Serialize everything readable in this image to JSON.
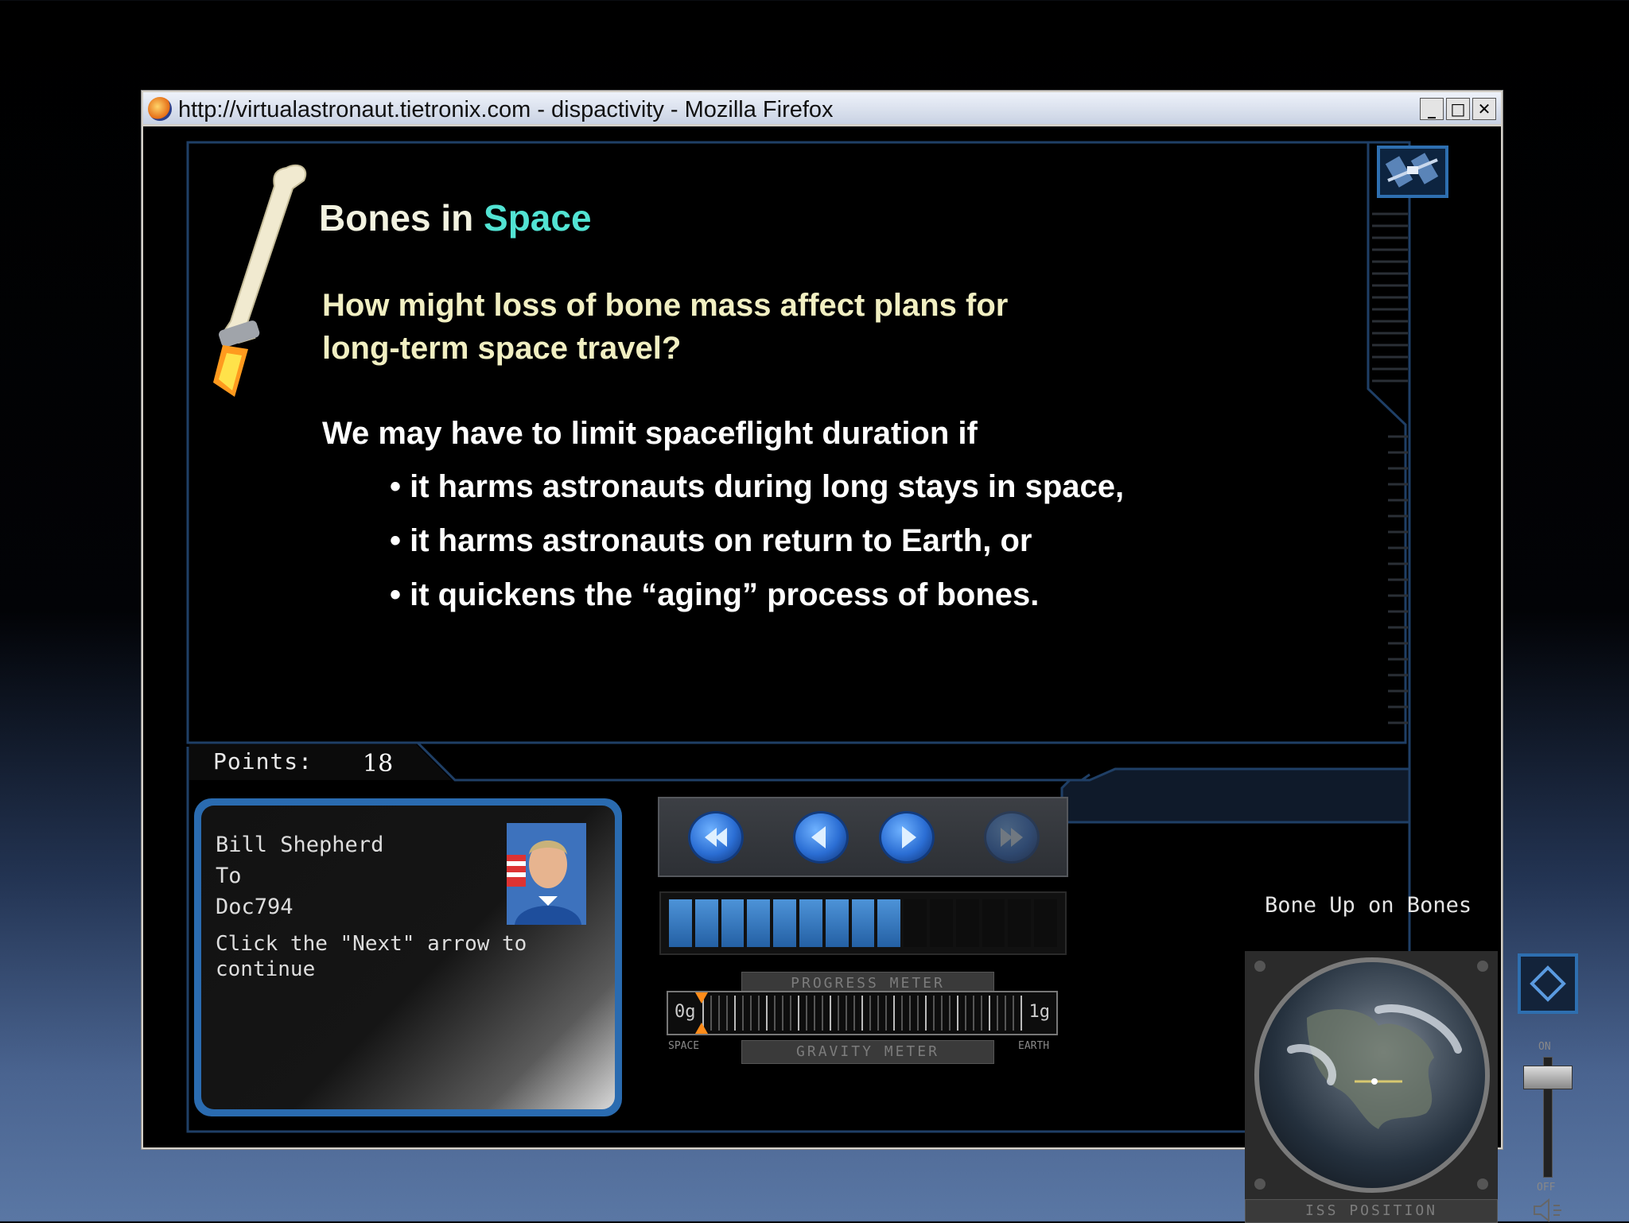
{
  "window": {
    "title": "http://virtualastronaut.tietronix.com - dispactivity - Mozilla Firefox",
    "controls": {
      "minimize": "_",
      "maximize": "□",
      "close": "✕"
    }
  },
  "slide": {
    "title_part1": "Bones in",
    "title_part2": "Space",
    "question": "How might loss of bone mass affect plans for long-term space travel?",
    "intro": "We may have to limit spaceflight duration if",
    "bullets": [
      "it harms astronauts during long stays in space,",
      "it harms astronauts on return to Earth, or",
      "it quickens the “aging” process of bones."
    ]
  },
  "points": {
    "label": "Points:",
    "value": "18"
  },
  "message": {
    "from": "Bill Shepherd",
    "to_label": "To",
    "to": "Doc794",
    "body": "Click the \"Next\" arrow to continue"
  },
  "progress_meter": {
    "label": "PROGRESS METER",
    "segments_total": 15,
    "segments_filled": 9
  },
  "gravity_meter": {
    "label": "GRAVITY METER",
    "min_label": "0g",
    "max_label": "1g",
    "left_caption": "SPACE",
    "right_caption": "EARTH",
    "level": 0.0
  },
  "lesson": {
    "title": "Bone Up on Bones"
  },
  "iss_position": {
    "label": "ISS POSITION"
  },
  "volume": {
    "on_label": "ON",
    "off_label": "OFF",
    "level": 0.93
  },
  "colors": {
    "accent_cyan": "#52e3d3",
    "question_yellow": "#f1efc2",
    "panel_blue": "#2a6bb0"
  },
  "icons": [
    "firefox-icon",
    "iss-icon",
    "first-icon",
    "prev-icon",
    "next-icon",
    "last-icon",
    "audio-icon",
    "speaker-icon"
  ]
}
